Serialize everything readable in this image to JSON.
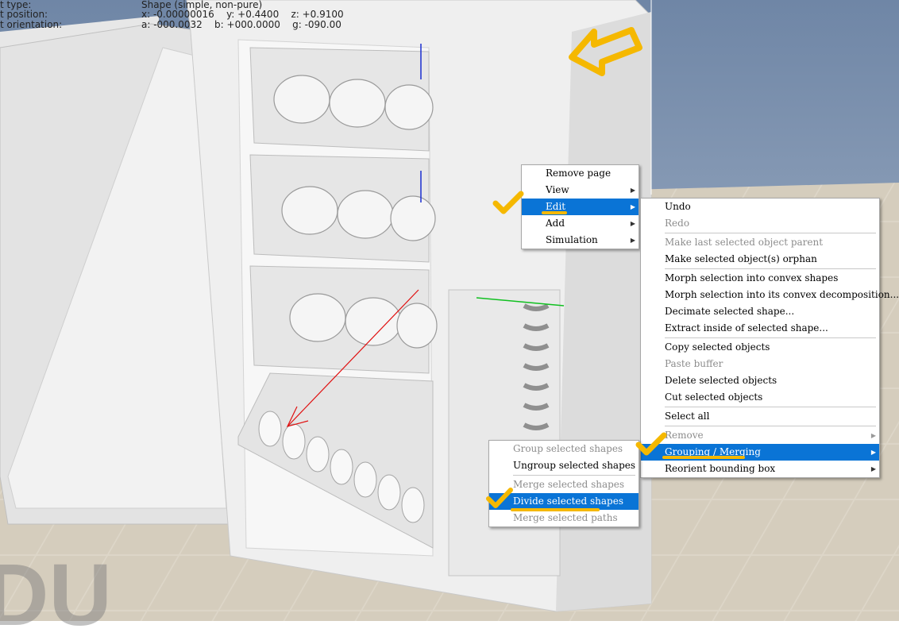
{
  "info": {
    "rows": [
      {
        "label": "t type:",
        "value": "Shape (simple, non-pure)"
      },
      {
        "label": "t position:",
        "value": "x: -0.00000016    y: +0.4400    z: +0.9100"
      },
      {
        "label": "t orientation:",
        "value": "a: -000.0032    b: +000.0000    g: -090.00"
      }
    ]
  },
  "context_menu": {
    "items": [
      {
        "label": "Remove page",
        "submenu": false
      },
      {
        "label": "View",
        "submenu": true
      },
      {
        "label": "Edit",
        "submenu": true,
        "highlighted": true
      },
      {
        "label": "Add",
        "submenu": true
      },
      {
        "label": "Simulation",
        "submenu": true
      }
    ]
  },
  "edit_menu": {
    "items": [
      {
        "label": "Undo",
        "enabled": true
      },
      {
        "label": "Redo",
        "enabled": false
      },
      {
        "label": "Make last selected object parent",
        "enabled": false
      },
      {
        "label": "Make selected object(s) orphan",
        "enabled": true
      },
      {
        "label": "Morph selection into convex shapes",
        "enabled": true
      },
      {
        "label": "Morph selection into its convex decomposition...",
        "enabled": true
      },
      {
        "label": "Decimate selected shape...",
        "enabled": true
      },
      {
        "label": "Extract inside of selected shape...",
        "enabled": true
      },
      {
        "label": "Copy selected objects",
        "enabled": true
      },
      {
        "label": "Paste buffer",
        "enabled": false
      },
      {
        "label": "Delete selected objects",
        "enabled": true
      },
      {
        "label": "Cut selected objects",
        "enabled": true
      },
      {
        "label": "Select all",
        "enabled": true
      },
      {
        "label": "Remove",
        "enabled": false,
        "submenu": true
      },
      {
        "label": "Grouping / Merging",
        "enabled": true,
        "submenu": true,
        "highlighted": true
      },
      {
        "label": "Reorient bounding box",
        "enabled": true,
        "submenu": true
      }
    ]
  },
  "grouping_menu": {
    "items": [
      {
        "label": "Group selected shapes",
        "enabled": false
      },
      {
        "label": "Ungroup selected shapes",
        "enabled": true
      },
      {
        "label": "Merge selected shapes",
        "enabled": false
      },
      {
        "label": "Divide selected shapes",
        "enabled": true,
        "highlighted": true
      },
      {
        "label": "Merge selected paths",
        "enabled": false
      }
    ]
  },
  "watermark": "DU",
  "colors": {
    "highlight": "#0a74d6",
    "annotation": "#f5b800",
    "floor": "#d9d2c4",
    "sky": "#8aa0bd"
  }
}
